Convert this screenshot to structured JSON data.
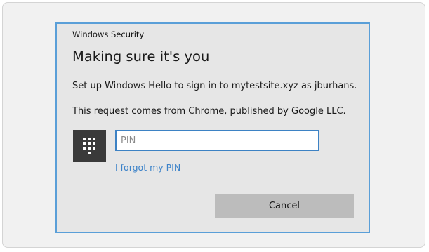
{
  "dialog": {
    "window_title": "Windows Security",
    "heading": "Making sure it's you",
    "message_1": "Set up Windows Hello to sign in to mytestsite.xyz as jburhans.",
    "message_2": "This request comes from Chrome, published by Google LLC.",
    "pin_icon": "keypad-icon",
    "pin_field": {
      "value": "",
      "placeholder": "PIN"
    },
    "forgot_pin_label": "I forgot my PIN",
    "cancel_label": "Cancel"
  },
  "colors": {
    "accent": "#3d82c4",
    "link": "#3d83c9",
    "dialog_border": "#5a9fd8",
    "dialog_background": "#e6e6e6",
    "button_background": "#bcbcbc",
    "icon_tile": "#3a3a3a"
  }
}
